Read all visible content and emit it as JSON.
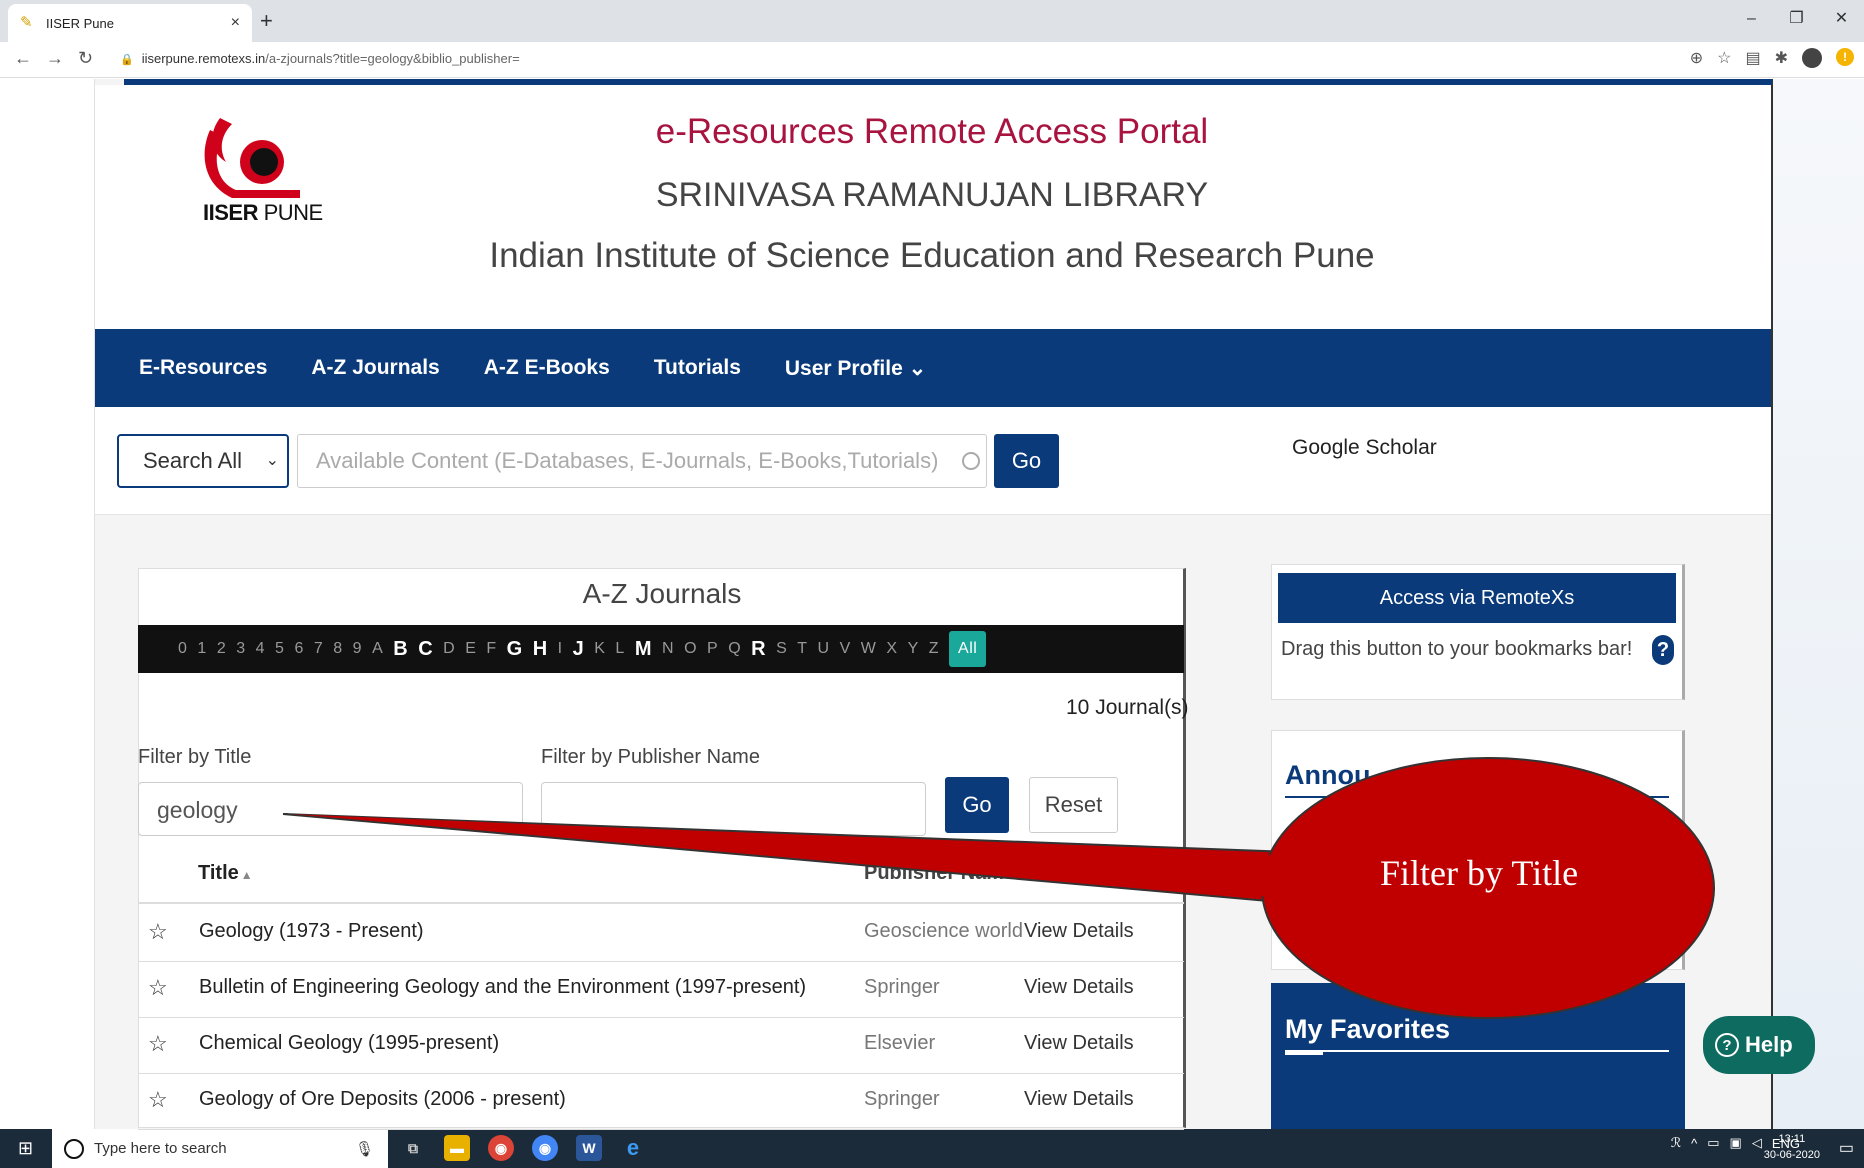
{
  "browser": {
    "tab_title": "IISER Pune",
    "tab_close": "×",
    "new_tab": "+",
    "url_host": "iiserpune.remotexs.in",
    "url_path": "/a-zjournals?title=geology&biblio_publisher=",
    "window_controls": [
      "–",
      "❐",
      "✕"
    ]
  },
  "header": {
    "logo_text_bold": "IISER",
    "logo_text_thin": "PUNE",
    "title": "e-Resources Remote Access Portal",
    "subtitle": "SRINIVASA RAMANUJAN LIBRARY",
    "institute": "Indian Institute of Science Education and Research Pune"
  },
  "nav": {
    "items": [
      "E-Resources",
      "A-Z Journals",
      "A-Z E-Books",
      "Tutorials",
      "User Profile ⌄"
    ]
  },
  "search": {
    "scope": "Search All",
    "placeholder": "Available Content (E-Databases, E-Journals, E-Books,Tutorials)",
    "go": "Go",
    "google_scholar": "Google Scholar"
  },
  "az": {
    "title": "A-Z Journals",
    "letters": [
      {
        "l": "0",
        "active": false
      },
      {
        "l": "1",
        "active": false
      },
      {
        "l": "2",
        "active": false
      },
      {
        "l": "3",
        "active": false
      },
      {
        "l": "4",
        "active": false
      },
      {
        "l": "5",
        "active": false
      },
      {
        "l": "6",
        "active": false
      },
      {
        "l": "7",
        "active": false
      },
      {
        "l": "8",
        "active": false
      },
      {
        "l": "9",
        "active": false
      },
      {
        "l": "A",
        "active": false
      },
      {
        "l": "B",
        "active": true
      },
      {
        "l": "C",
        "active": true
      },
      {
        "l": "D",
        "active": false
      },
      {
        "l": "E",
        "active": false
      },
      {
        "l": "F",
        "active": false
      },
      {
        "l": "G",
        "active": true
      },
      {
        "l": "H",
        "active": true
      },
      {
        "l": "I",
        "active": false
      },
      {
        "l": "J",
        "active": true
      },
      {
        "l": "K",
        "active": false
      },
      {
        "l": "L",
        "active": false
      },
      {
        "l": "M",
        "active": true
      },
      {
        "l": "N",
        "active": false
      },
      {
        "l": "O",
        "active": false
      },
      {
        "l": "P",
        "active": false
      },
      {
        "l": "Q",
        "active": false
      },
      {
        "l": "R",
        "active": true
      },
      {
        "l": "S",
        "active": false
      },
      {
        "l": "T",
        "active": false
      },
      {
        "l": "U",
        "active": false
      },
      {
        "l": "V",
        "active": false
      },
      {
        "l": "W",
        "active": false
      },
      {
        "l": "X",
        "active": false
      },
      {
        "l": "Y",
        "active": false
      },
      {
        "l": "Z",
        "active": false
      }
    ],
    "all_label": "All",
    "count": "10 Journal(s)",
    "filter_title_label": "Filter by Title",
    "filter_publisher_label": "Filter by Publisher Name",
    "filter_title_value": "geology",
    "filter_publisher_value": "",
    "go": "Go",
    "reset": "Reset",
    "col_title": "Title",
    "col_publisher": "Publisher Name",
    "rows": [
      {
        "title": "Geology (1973 - Present)",
        "publisher": "Geoscience world",
        "action": "View Details"
      },
      {
        "title": "Bulletin of Engineering Geology and the Environment (1997-present)",
        "publisher": "Springer",
        "action": "View Details"
      },
      {
        "title": "Chemical Geology (1995-present)",
        "publisher": "Elsevier",
        "action": "View Details"
      },
      {
        "title": "Geology of Ore Deposits (2006 - present)",
        "publisher": "Springer",
        "action": "View Details"
      }
    ]
  },
  "sidebar": {
    "access_button": "Access via RemoteXs",
    "drag_text": "Drag this button to your bookmarks bar!",
    "help_q": "?",
    "announcements_title": "Annou",
    "favorites_title": "My Favorites"
  },
  "help_button": "Help",
  "callout": "Filter by Title",
  "taskbar": {
    "search_placeholder": "Type here to search",
    "lang": "ENG",
    "time": "13:11",
    "date": "30-06-2020"
  },
  "colors": {
    "brand_blue": "#0a3a7a",
    "brand_red": "#a8143f",
    "callout_red": "#c00000",
    "all_teal": "#1aa89a",
    "help_green": "#0e6b5f"
  }
}
